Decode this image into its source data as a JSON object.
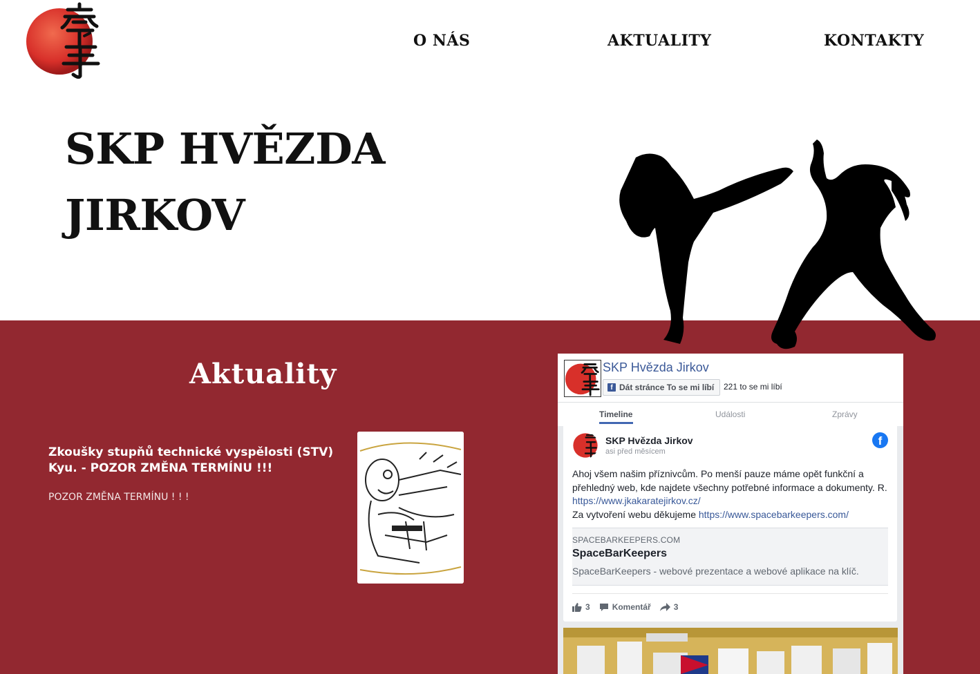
{
  "header": {
    "logo_alt": "SKP Hvězda Jirkov logo",
    "nav": [
      {
        "label": "O NÁS"
      },
      {
        "label": "AKTUALITY"
      },
      {
        "label": "KONTAKTY"
      }
    ]
  },
  "hero": {
    "title_line1": "SKP HVĚZDA",
    "title_line2": "JIRKOV"
  },
  "news": {
    "heading": "Aktuality",
    "items": [
      {
        "title": "Zkoušky stupňů technické vyspělosti (STV) Kyu. - POZOR ZMĚNA TERMÍNU !!!",
        "excerpt": "POZOR ZMĚNA TERMÍNU ! ! !"
      }
    ]
  },
  "facebook": {
    "page_name": "SKP Hvězda Jirkov",
    "like_button": "Dát stránce To se mi líbí",
    "like_count": "221 to se mi líbí",
    "tabs": [
      {
        "label": "Timeline",
        "active": true
      },
      {
        "label": "Události",
        "active": false
      },
      {
        "label": "Zprávy",
        "active": false
      }
    ],
    "post": {
      "author": "SKP Hvězda Jirkov",
      "time": "asi před měsícem",
      "text_line1": "Ahoj všem našim příznivcům. Po menší pauze máme opět funkční a přehledný web, kde najdete všechny potřebné informace a dokumenty. R.",
      "link1": "https://www.jkakaratejirkov.cz/",
      "text_line2": "Za vytvoření webu děkujeme ",
      "link2": "https://www.spacebarkeepers.com/",
      "card": {
        "domain": "SPACEBARKEEPERS.COM",
        "title": "SpaceBarKeepers",
        "description": "SpaceBarKeepers - webové prezentace a webové aplikace na klíč."
      },
      "likes": "3",
      "comment_label": "Komentář",
      "shares": "3"
    }
  },
  "colors": {
    "band": "#922830",
    "logo_red": "#d8302a",
    "fb_blue": "#3b5998"
  }
}
